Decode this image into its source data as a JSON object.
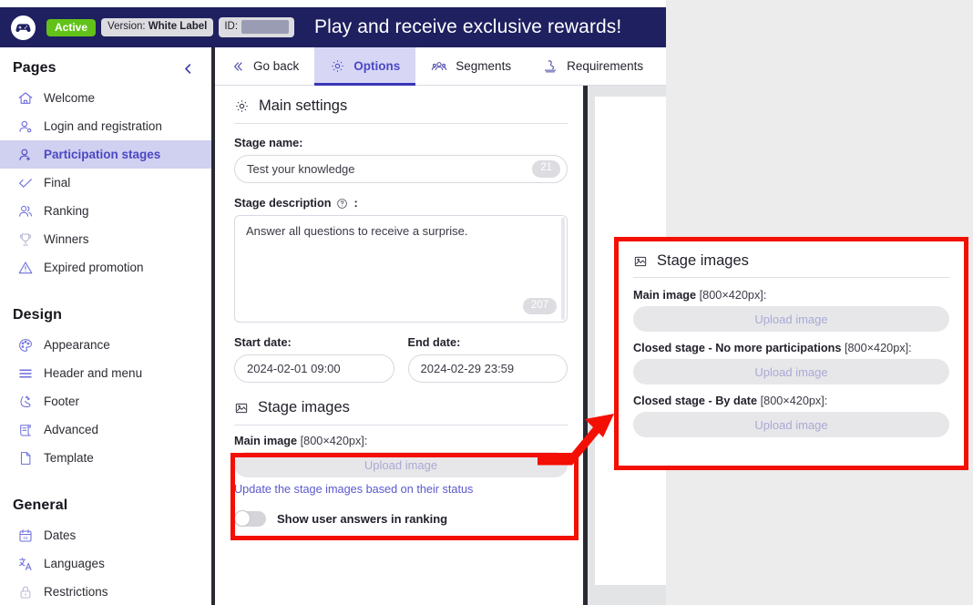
{
  "topbar": {
    "logo_icon": "gamepad-icon",
    "status_badge": "Active",
    "version_prefix": "Version:",
    "version_value": "White Label",
    "id_prefix": "ID:",
    "id_value": "",
    "title": "Play and receive exclusive rewards!",
    "bg_color": "#1f2060",
    "active_badge_color": "#62c219"
  },
  "sidebar": {
    "sections": [
      {
        "title": "Pages",
        "collapse_icon": "chevron-left-icon",
        "items": [
          {
            "label": "Welcome",
            "icon": "home-icon",
            "active": false
          },
          {
            "label": "Login and registration",
            "icon": "user-login-icon",
            "active": false
          },
          {
            "label": "Participation stages",
            "icon": "user-stages-icon",
            "active": true
          },
          {
            "label": "Final",
            "icon": "check-icon",
            "active": false
          },
          {
            "label": "Ranking",
            "icon": "users-ranking-icon",
            "active": false
          },
          {
            "label": "Winners",
            "icon": "trophy-icon",
            "active": false
          },
          {
            "label": "Expired promotion",
            "icon": "warning-triangle-icon",
            "active": false
          }
        ]
      },
      {
        "title": "Design",
        "items": [
          {
            "label": "Appearance",
            "icon": "palette-icon",
            "active": false
          },
          {
            "label": "Header and menu",
            "icon": "menu-lines-icon",
            "active": false
          },
          {
            "label": "Footer",
            "icon": "footer-shoe-icon",
            "active": false
          },
          {
            "label": "Advanced",
            "icon": "scroll-document-icon",
            "active": false
          },
          {
            "label": "Template",
            "icon": "page-icon",
            "active": false
          }
        ]
      },
      {
        "title": "General",
        "items": [
          {
            "label": "Dates",
            "icon": "calendar-icon",
            "active": false
          },
          {
            "label": "Languages",
            "icon": "translate-icon",
            "active": false
          },
          {
            "label": "Restrictions",
            "icon": "lock-icon",
            "active": false,
            "dim": true
          }
        ]
      }
    ],
    "active_bg_color": "#d0d0f0",
    "active_text_color": "#4b48c4"
  },
  "tabs": [
    {
      "label": "Go back",
      "icon": "double-chevron-left-icon",
      "selected": false
    },
    {
      "label": "Options",
      "icon": "gear-icon",
      "selected": true
    },
    {
      "label": "Segments",
      "icon": "segments-people-icon",
      "selected": false
    },
    {
      "label": "Requirements",
      "icon": "stamp-icon",
      "selected": false
    }
  ],
  "main": {
    "settings_section": {
      "title": "Main settings",
      "icon": "gear-icon"
    },
    "stage_name": {
      "label": "Stage name:",
      "value": "Test your knowledge",
      "counter": "21"
    },
    "stage_description": {
      "label": "Stage description",
      "label_suffix": ":",
      "help_icon": "question-circle-icon",
      "value": "Answer all questions to receive a surprise.",
      "counter": "207"
    },
    "start_date": {
      "label": "Start date:",
      "value": "2024-02-01 09:00"
    },
    "end_date": {
      "label": "End date:",
      "value": "2024-02-29 23:59"
    },
    "stage_images_section": {
      "title": "Stage images",
      "icon": "image-icon",
      "main_image_label": "Main image",
      "main_image_dims": "[800×420px]:",
      "upload_label": "Upload image",
      "status_link": "Update the stage images based on their status"
    },
    "toggle": {
      "label": "Show user answers in ranking",
      "state": "off"
    }
  },
  "callout": {
    "title": "Stage images",
    "icon": "image-icon",
    "border_color": "#f40f04",
    "groups": [
      {
        "label": "Main image",
        "dims": "[800×420px]:",
        "upload_label": "Upload image"
      },
      {
        "label": "Closed stage - No more participations",
        "dims": "[800×420px]:",
        "upload_label": "Upload image"
      },
      {
        "label": "Closed stage - By date",
        "dims": "[800×420px]:",
        "upload_label": "Upload image"
      }
    ]
  }
}
